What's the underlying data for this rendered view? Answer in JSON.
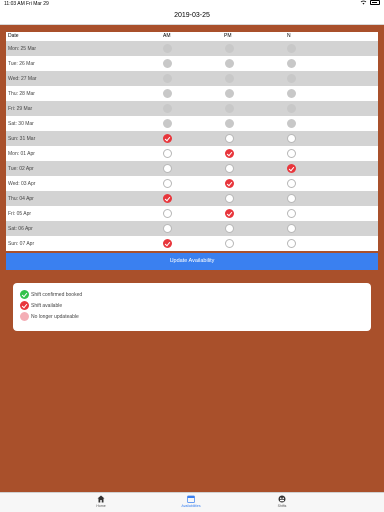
{
  "status_bar": {
    "time": "11:03 AM",
    "date": "Fri Mar 29"
  },
  "nav": {
    "title": "2019-03-25"
  },
  "table": {
    "headers": {
      "date": "Date",
      "am": "AM",
      "pm": "PM",
      "n": "N"
    },
    "rows": [
      {
        "date": "Mon: 25 Mar",
        "past": true,
        "am": "none",
        "pm": "none",
        "n": "none"
      },
      {
        "date": "Tue: 26 Mar",
        "past": false,
        "am": "none",
        "pm": "none",
        "n": "none"
      },
      {
        "date": "Wed: 27 Mar",
        "past": true,
        "am": "none",
        "pm": "none",
        "n": "none"
      },
      {
        "date": "Thu: 28 Mar",
        "past": false,
        "am": "none",
        "pm": "none",
        "n": "none"
      },
      {
        "date": "Fri: 29 Mar",
        "past": true,
        "am": "none",
        "pm": "none",
        "n": "none"
      },
      {
        "date": "Sat: 30 Mar",
        "past": false,
        "am": "none",
        "pm": "none",
        "n": "none"
      },
      {
        "date": "Sun: 31 Mar",
        "past": true,
        "am": "selected",
        "pm": "empty",
        "n": "empty"
      },
      {
        "date": "Mon: 01 Apr",
        "past": false,
        "am": "empty",
        "pm": "selected",
        "n": "empty"
      },
      {
        "date": "Tue: 02 Apr",
        "past": true,
        "am": "empty",
        "pm": "empty",
        "n": "selected"
      },
      {
        "date": "Wed: 03 Apr",
        "past": false,
        "am": "empty",
        "pm": "selected",
        "n": "empty"
      },
      {
        "date": "Thu: 04 Apr",
        "past": true,
        "am": "selected",
        "pm": "empty",
        "n": "empty"
      },
      {
        "date": "Fri: 05 Apr",
        "past": false,
        "am": "empty",
        "pm": "selected",
        "n": "empty"
      },
      {
        "date": "Sat: 06 Apr",
        "past": true,
        "am": "empty",
        "pm": "empty",
        "n": "empty"
      },
      {
        "date": "Sun: 07 Apr",
        "past": false,
        "am": "selected",
        "pm": "empty",
        "n": "empty"
      }
    ]
  },
  "update_button": {
    "label": "Update Availability"
  },
  "legend": {
    "items": [
      {
        "label": "Shift confirmed booked",
        "color": "#33c24a"
      },
      {
        "label": "Shift available",
        "color": "#e8363c"
      },
      {
        "label": "No longer updateable",
        "color": "#f4aeb6"
      }
    ]
  },
  "tabs": [
    {
      "label": "Home",
      "icon": "home-icon",
      "active": false
    },
    {
      "label": "Availabilities",
      "icon": "calendar-icon",
      "active": true
    },
    {
      "label": "Shifts",
      "icon": "shifts-icon",
      "active": false
    }
  ],
  "colors": {
    "background": "#a9502b",
    "accent": "#3a80f0",
    "selected": "#e8363c",
    "confirmed": "#33c24a"
  }
}
